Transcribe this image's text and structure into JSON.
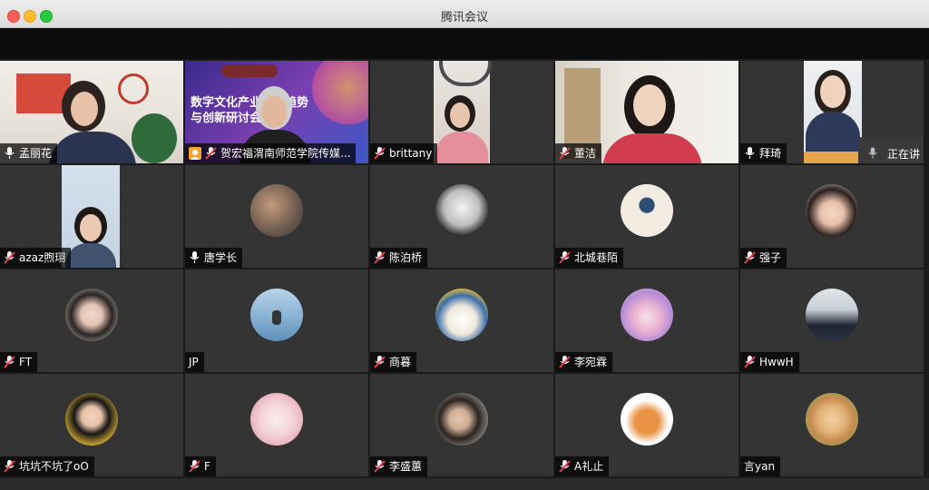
{
  "window": {
    "title": "腾讯会议"
  },
  "share_label": "正在讲",
  "tiles": [
    {
      "name": "孟丽花",
      "mic": "on"
    },
    {
      "name": "贺宏福渭南师范学院传媒...",
      "mic": "muted"
    },
    {
      "name": "brittany",
      "mic": "muted"
    },
    {
      "name": "董洁",
      "mic": "muted"
    },
    {
      "name": "拜琦",
      "mic": "on"
    },
    {
      "name": "azaz煦珝",
      "mic": "muted"
    },
    {
      "name": "唐学长",
      "mic": "on"
    },
    {
      "name": "陈泊桥",
      "mic": "muted"
    },
    {
      "name": "北城巷陌",
      "mic": "muted"
    },
    {
      "name": "强子",
      "mic": "muted"
    },
    {
      "name": "FT",
      "mic": "muted"
    },
    {
      "name": "JP",
      "mic": "none"
    },
    {
      "name": "商暮",
      "mic": "muted"
    },
    {
      "name": "李宛霖",
      "mic": "muted"
    },
    {
      "name": "HwwH",
      "mic": "muted"
    },
    {
      "name": "坑坑不坑了oO",
      "mic": "muted"
    },
    {
      "name": "F",
      "mic": "muted"
    },
    {
      "name": "李盛蕙",
      "mic": "muted"
    },
    {
      "name": "A礼止",
      "mic": "muted"
    },
    {
      "name": "言yan",
      "mic": "none"
    }
  ],
  "slide_banner": {
    "line1": "数字文化产业发展趋势",
    "line2": "与创新研讨会"
  },
  "colors": {
    "active_border": "#3fcf6a",
    "tile_bg": "#343434",
    "muted_red": "#e8404a"
  }
}
